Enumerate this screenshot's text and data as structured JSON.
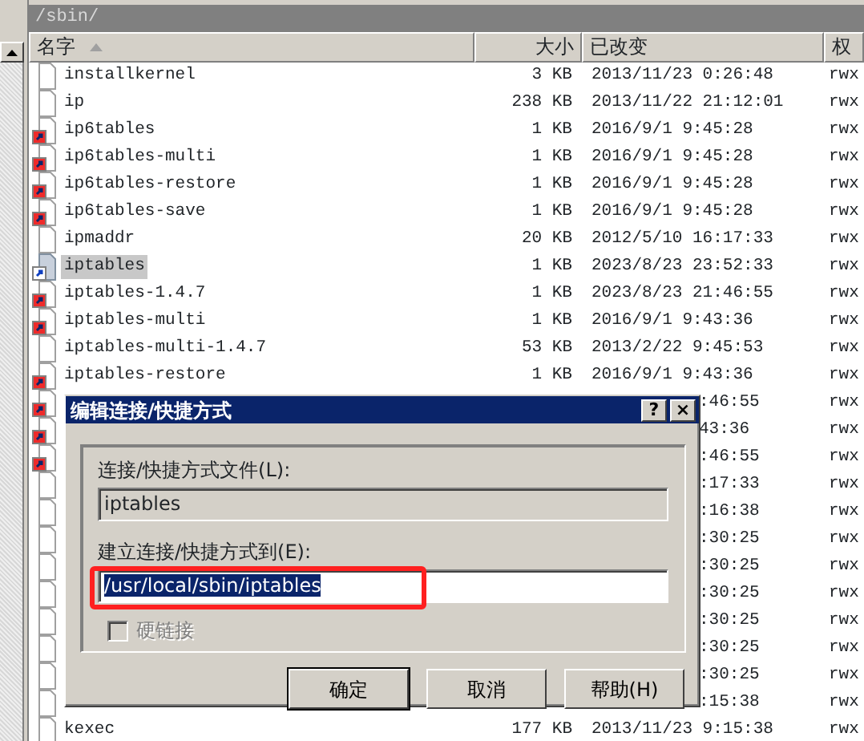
{
  "path": "/sbin/",
  "columns": [
    {
      "label": "名字",
      "sorted": true
    },
    {
      "label": "大小"
    },
    {
      "label": "已改变"
    },
    {
      "label": "权"
    }
  ],
  "rows": [
    {
      "kind": "file",
      "name": "installkernel",
      "size": "3 KB",
      "changed": "2013/11/23 0:26:48",
      "perms": "rwx",
      "selected": false
    },
    {
      "kind": "file",
      "name": "ip",
      "size": "238 KB",
      "changed": "2013/11/22 21:12:01",
      "perms": "rwx",
      "selected": false
    },
    {
      "kind": "shortcut",
      "name": "ip6tables",
      "size": "1 KB",
      "changed": "2016/9/1 9:45:28",
      "perms": "rwx",
      "selected": false
    },
    {
      "kind": "shortcut",
      "name": "ip6tables-multi",
      "size": "1 KB",
      "changed": "2016/9/1 9:45:28",
      "perms": "rwx",
      "selected": false
    },
    {
      "kind": "shortcut",
      "name": "ip6tables-restore",
      "size": "1 KB",
      "changed": "2016/9/1 9:45:28",
      "perms": "rwx",
      "selected": false
    },
    {
      "kind": "shortcut",
      "name": "ip6tables-save",
      "size": "1 KB",
      "changed": "2016/9/1 9:45:28",
      "perms": "rwx",
      "selected": false
    },
    {
      "kind": "file",
      "name": "ipmaddr",
      "size": "20 KB",
      "changed": "2012/5/10 16:17:33",
      "perms": "rwx",
      "selected": false
    },
    {
      "kind": "link",
      "name": "iptables",
      "size": "1 KB",
      "changed": "2023/8/23 23:52:33",
      "perms": "rwx",
      "selected": true
    },
    {
      "kind": "shortcut",
      "name": "iptables-1.4.7",
      "size": "1 KB",
      "changed": "2023/8/23 21:46:55",
      "perms": "rwx",
      "selected": false
    },
    {
      "kind": "shortcut",
      "name": "iptables-multi",
      "size": "1 KB",
      "changed": "2016/9/1 9:43:36",
      "perms": "rwx",
      "selected": false
    },
    {
      "kind": "file",
      "name": "iptables-multi-1.4.7",
      "size": "53 KB",
      "changed": "2013/2/22 9:45:53",
      "perms": "rwx",
      "selected": false
    },
    {
      "kind": "shortcut",
      "name": "iptables-restore",
      "size": "1 KB",
      "changed": "2016/9/1 9:43:36",
      "perms": "rwx",
      "selected": false
    },
    {
      "kind": "shortcut",
      "changed": ":46:55",
      "perms": "rwx"
    },
    {
      "kind": "shortcut",
      "changed": "43:36",
      "perms": "rwx"
    },
    {
      "kind": "shortcut",
      "changed": ":46:55",
      "perms": "rwx"
    },
    {
      "kind": "file",
      "changed": ":17:33",
      "perms": "rwx"
    },
    {
      "kind": "file",
      "changed": ":16:38",
      "perms": "rwx"
    },
    {
      "kind": "file",
      "changed": ":30:25",
      "perms": "rwx"
    },
    {
      "kind": "file",
      "changed": ":30:25",
      "perms": "rwx"
    },
    {
      "kind": "file",
      "changed": ":30:25",
      "perms": "rwx"
    },
    {
      "kind": "file",
      "changed": ":30:25",
      "perms": "rwx"
    },
    {
      "kind": "file",
      "changed": ":30:25",
      "perms": "rwx"
    },
    {
      "kind": "file",
      "changed": ":30:25",
      "perms": "rwx"
    },
    {
      "kind": "file",
      "changed": ":15:38",
      "perms": "rwx"
    },
    {
      "kind": "file",
      "name": "kexec",
      "size": "177 KB",
      "changed": "2013/11/23 9:15:38",
      "perms": "rwx",
      "selected": false
    }
  ],
  "dialog": {
    "title": "编辑连接/快捷方式",
    "help_button": "?",
    "close_button": "×",
    "fields": [
      {
        "label": "连接/快捷方式文件(L):",
        "value": "iptables",
        "readonly": true,
        "text_selected": false
      },
      {
        "label": "建立连接/快捷方式到(E):",
        "value": "/usr/local/sbin/iptables",
        "readonly": false,
        "text_selected": true
      }
    ],
    "hard_link": {
      "label": "硬链接",
      "checked": false,
      "disabled": true
    },
    "buttons": [
      {
        "label": "确定",
        "default": true
      },
      {
        "label": "取消",
        "default": false
      },
      {
        "label": "帮助(H)",
        "default": false
      }
    ]
  }
}
